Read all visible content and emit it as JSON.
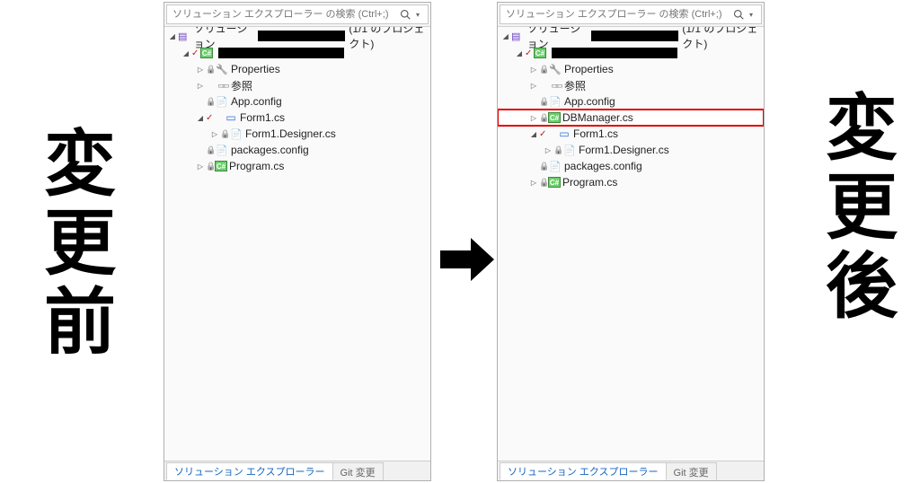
{
  "labels": {
    "before": "変更前",
    "after": "変更後"
  },
  "search": {
    "placeholder": "ソリューション エクスプローラー の検索 (Ctrl+;)"
  },
  "solution": {
    "prefix": "ソリューション",
    "count": "(1/1 のプロジェクト)"
  },
  "tabs": {
    "active": "ソリューション エクスプローラー",
    "other": "Git 変更"
  },
  "leftTree": [
    {
      "indent": 1,
      "expander": "closed",
      "lock": true,
      "icon": "props",
      "label": "Properties"
    },
    {
      "indent": 1,
      "expander": "closed",
      "lock": false,
      "icon": "refs",
      "label": "参照"
    },
    {
      "indent": 1,
      "expander": "none",
      "lock": true,
      "icon": "config",
      "label": "App.config"
    },
    {
      "indent": 1,
      "expander": "open",
      "lock": false,
      "icon": "form",
      "label": "Form1.cs",
      "check": true
    },
    {
      "indent": 2,
      "expander": "closed",
      "lock": true,
      "icon": "doc",
      "label": "Form1.Designer.cs"
    },
    {
      "indent": 1,
      "expander": "none",
      "lock": true,
      "icon": "config",
      "label": "packages.config"
    },
    {
      "indent": 1,
      "expander": "closed",
      "lock": true,
      "icon": "cs",
      "label": "Program.cs"
    }
  ],
  "rightTree": [
    {
      "indent": 1,
      "expander": "closed",
      "lock": true,
      "icon": "props",
      "label": "Properties"
    },
    {
      "indent": 1,
      "expander": "closed",
      "lock": false,
      "icon": "refs",
      "label": "参照"
    },
    {
      "indent": 1,
      "expander": "none",
      "lock": true,
      "icon": "config",
      "label": "App.config"
    },
    {
      "indent": 1,
      "expander": "closed",
      "lock": true,
      "icon": "cs",
      "label": "DBManager.cs",
      "highlight": true
    },
    {
      "indent": 1,
      "expander": "open",
      "lock": false,
      "icon": "form",
      "label": "Form1.cs",
      "check": true
    },
    {
      "indent": 2,
      "expander": "closed",
      "lock": true,
      "icon": "doc",
      "label": "Form1.Designer.cs"
    },
    {
      "indent": 1,
      "expander": "none",
      "lock": true,
      "icon": "config",
      "label": "packages.config"
    },
    {
      "indent": 1,
      "expander": "closed",
      "lock": true,
      "icon": "cs",
      "label": "Program.cs"
    }
  ]
}
